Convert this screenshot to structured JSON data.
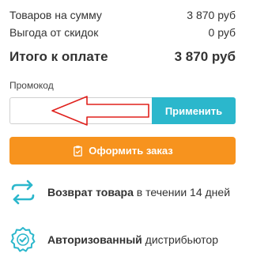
{
  "summary": {
    "goods_label": "Товаров на сумму",
    "goods_value": "3 870 руб",
    "discount_label": "Выгода от скидок",
    "discount_value": "0 руб",
    "total_label": "Итого к оплате",
    "total_value": "3 870 руб"
  },
  "promo": {
    "label": "Промокод",
    "value": "",
    "placeholder": "",
    "apply_label": "Применить"
  },
  "order": {
    "button_label": "Оформить заказ"
  },
  "features": {
    "return_bold": "Возврат товара",
    "return_rest": " в течении 14 дней",
    "dist_bold": "Авторизованный",
    "dist_rest": " дистрибьютор"
  },
  "colors": {
    "accent_blue": "#2bb7cc",
    "accent_orange": "#f7931e",
    "annotation_red": "#e0201c"
  }
}
